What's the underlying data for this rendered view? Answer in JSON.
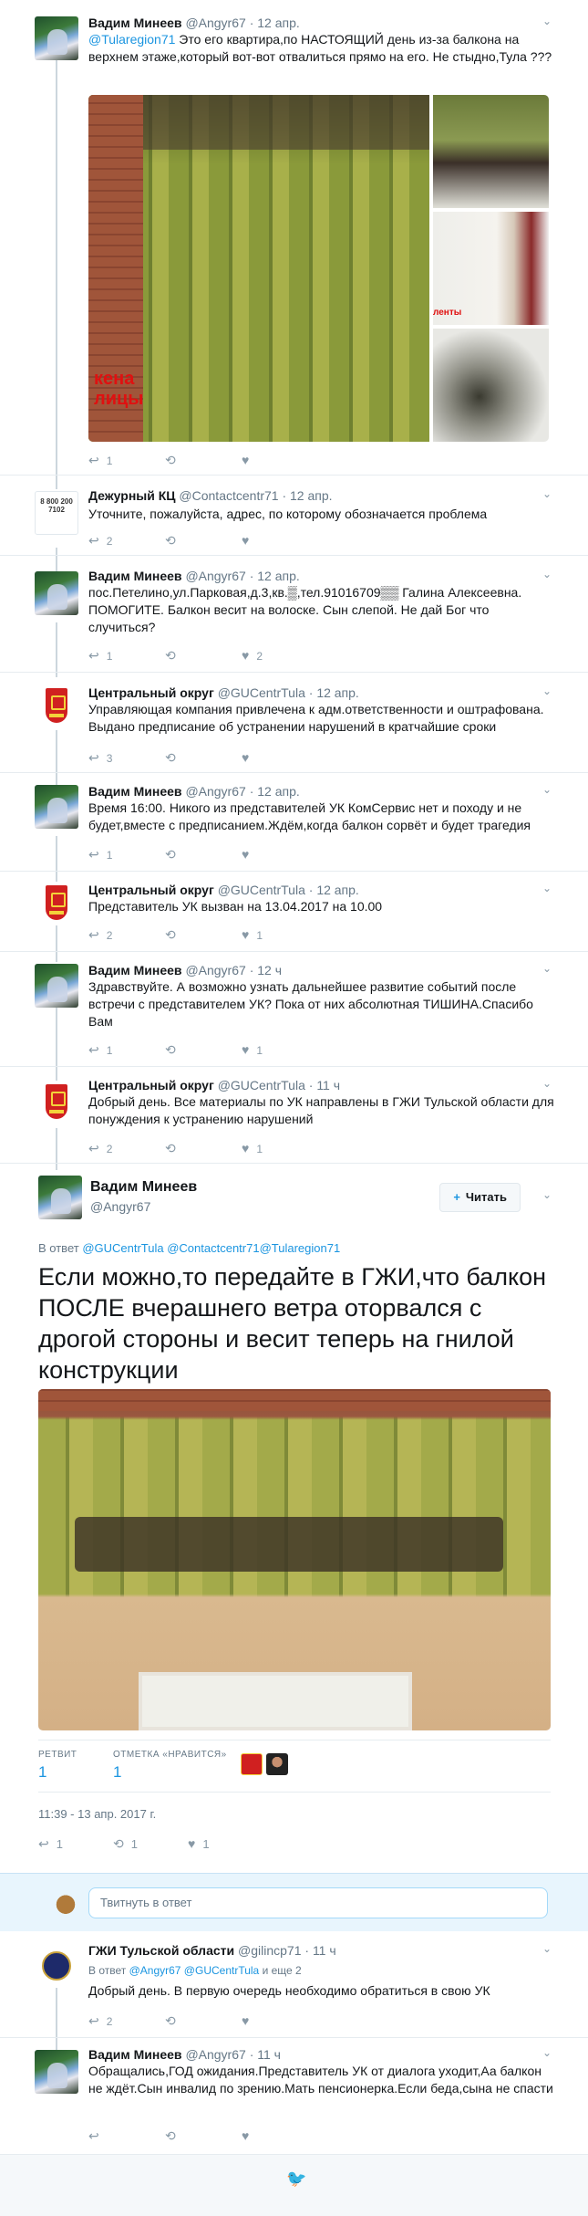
{
  "icons": {
    "reply": "↩",
    "retweet": "⟲",
    "like": "♥",
    "caret": "⌄",
    "follow": "+",
    "bird": "🐦"
  },
  "tweets": [
    {
      "name": "Вадим Минеев",
      "handle": "@Angyr67",
      "time": "12 апр.",
      "mention": "@Tularegion71",
      "text": " Это его квартира,по НАСТОЯЩИЙ день из-за балкона на верхнем этаже,который вот-вот отвалиться прямо на его. Не стыдно,Тула ???",
      "photo_label": "кена лицы",
      "thumb_label": "ленты",
      "reply_count": "1",
      "retweet_count": "",
      "like_count": ""
    },
    {
      "name": "Дежурный КЦ",
      "handle": "@Contactcentr71",
      "time": "12 апр.",
      "avatar_text": "8 800 200 7102",
      "text": "Уточните, пожалуйста, адрес, по которому обозначается проблема",
      "reply_count": "2",
      "retweet_count": "",
      "like_count": ""
    },
    {
      "name": "Вадим Минеев",
      "handle": "@Angyr67",
      "time": "12 апр.",
      "text": "пос.Петелино,ул.Парковая,д.3,кв.▒,тел.91016709▒▒ Галина Алексеевна. ПОМОГИТЕ. Балкон весит на волоске. Сын слепой. Не дай Бог что случиться?",
      "reply_count": "1",
      "retweet_count": "",
      "like_count": "2"
    },
    {
      "name": "Центральный округ",
      "handle": "@GUCentrTula",
      "time": "12 апр.",
      "text": "Управляющая компания привлечена к адм.ответственности и оштрафована. Выдано предписание об устранении нарушений в кратчайшие сроки",
      "reply_count": "3",
      "retweet_count": "",
      "like_count": ""
    },
    {
      "name": "Вадим Минеев",
      "handle": "@Angyr67",
      "time": "12 апр.",
      "text": "Время 16:00. Никого из представителей УК КомСервис нет и походу и не будет,вместе с предписанием.Ждём,когда балкон сорвёт и будет трагедия",
      "reply_count": "1",
      "retweet_count": "",
      "like_count": ""
    },
    {
      "name": "Центральный округ",
      "handle": "@GUCentrTula",
      "time": "12 апр.",
      "text": "Представитель УК вызван на 13.04.2017 на 10.00",
      "reply_count": "2",
      "retweet_count": "",
      "like_count": "1"
    },
    {
      "name": "Вадим Минеев",
      "handle": "@Angyr67",
      "time": "12 ч",
      "text": "Здравствуйте. А возможно узнать дальнейшее развитие событий после встречи с представителем УК? Пока от них абсолютная ТИШИНА.Спасибо Вам",
      "reply_count": "1",
      "retweet_count": "",
      "like_count": "1"
    },
    {
      "name": "Центральный округ",
      "handle": "@GUCentrTula",
      "time": "11 ч",
      "text": "Добрый день. Все материалы по УК направлены в ГЖИ Тульской области для понуждения к устранению нарушений",
      "reply_count": "2",
      "retweet_count": "",
      "like_count": "1"
    }
  ],
  "focused": {
    "name": "Вадим Минеев",
    "handle": "@Angyr67",
    "follow_label": "Читать",
    "reply_prefix": "В ответ ",
    "reply_mentions": "@GUCentrTula @Contactcentr71@Tularegion71",
    "text": "Если можно,то передайте в ГЖИ,что балкон ПОСЛЕ вчерашнего ветра оторвался с дрогой стороны и весит теперь на гнилой конструкции",
    "retweets_label": "РЕТВИТ",
    "retweets_value": "1",
    "likes_label": "ОТМЕТКА «НРАВИТСЯ»",
    "likes_value": "1",
    "timestamp": "11:39 - 13 апр. 2017 г.",
    "reply_count": "1",
    "retweet_count": "1",
    "like_count": "1"
  },
  "reply_box": {
    "placeholder": "Твитнуть в ответ"
  },
  "replies": [
    {
      "name": "ГЖИ Тульской области",
      "handle": "@gilincp71",
      "time": "11 ч",
      "reply_to_prefix": "В ответ ",
      "reply_to_mentions": "@Angyr67 @GUCentrTula",
      "reply_to_suffix": " и еще 2",
      "text": "Добрый день. В первую очередь необходимо обратиться в свою УК",
      "reply_count": "2",
      "retweet_count": "",
      "like_count": ""
    },
    {
      "name": "Вадим Минеев",
      "handle": "@Angyr67",
      "time": "11 ч",
      "text": "Обращались,ГОД ожидания.Представитель УК от диалога уходит,Аа балкон не ждёт.Сын инвалид по зрению.Мать пенсионерка.Если беда,сына не спасти",
      "reply_count": "",
      "retweet_count": "",
      "like_count": ""
    }
  ]
}
